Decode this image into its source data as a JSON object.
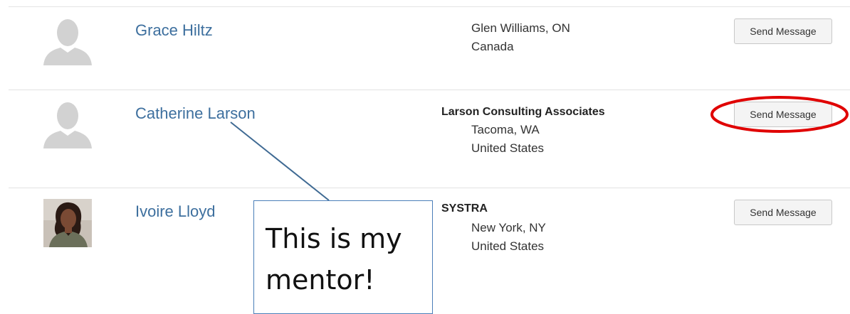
{
  "members": [
    {
      "name": "Grace Hiltz",
      "organization": "",
      "city_state": "Glen Williams, ON",
      "country": "Canada",
      "avatar": "default-avatar-icon",
      "button_label": "Send Message"
    },
    {
      "name": "Catherine Larson",
      "organization": "Larson Consulting Associates",
      "city_state": "Tacoma, WA",
      "country": "United States",
      "avatar": "default-avatar-icon",
      "button_label": "Send Message"
    },
    {
      "name": "Ivoire Lloyd",
      "organization": "SYSTRA",
      "city_state": "New York, NY",
      "country": "United States",
      "avatar": "profile-photo",
      "button_label": "Send Message"
    }
  ],
  "annotation": {
    "text_line1": "This is my",
    "text_line2": "mentor!",
    "circle_color": "#e00000",
    "box_border_color": "#4a7eb8"
  },
  "colors": {
    "name_link": "#3d6f9e",
    "divider": "#e3e3e3"
  }
}
